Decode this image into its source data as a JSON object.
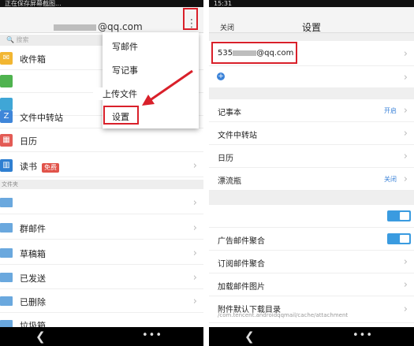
{
  "left": {
    "status_text": "正在保存屏幕截图...",
    "account_email_suffix": "@qq.com",
    "search_placeholder": "搜索",
    "rows": [
      {
        "label": "收件箱",
        "icon": "inbox-icon",
        "color": "#f2b632"
      },
      {
        "label": "",
        "icon": "star-icon",
        "color": "#4fb34f"
      },
      {
        "label": "",
        "icon": "contacts-icon",
        "color": "#3fa6d6"
      },
      {
        "label": "文件中转站",
        "icon": "transfer-icon",
        "color": "#3f86d9"
      },
      {
        "label": "日历",
        "icon": "calendar-icon",
        "color": "#e35b55"
      },
      {
        "label": "读书",
        "icon": "book-icon",
        "color": "#2f7fd1",
        "badge": "免费"
      }
    ],
    "section_label": "文件夹",
    "folders": [
      "",
      "群邮件",
      "草稿箱",
      "已发送",
      "已删除",
      "垃圾箱"
    ],
    "menu": {
      "items": [
        "写邮件",
        "写记事",
        "上传文件",
        "设置"
      ]
    }
  },
  "right": {
    "status_time": "15:31",
    "close_label": "关闭",
    "title": "设置",
    "account_prefix": "535",
    "account_suffix": "@qq.com",
    "items": [
      {
        "label": "记事本",
        "value": "开启"
      },
      {
        "label": "文件中转站",
        "value": ""
      },
      {
        "label": "日历",
        "value": ""
      },
      {
        "label": "漂流瓶",
        "value": "关闭"
      }
    ],
    "toggles": [
      {
        "label": "",
        "on": true
      },
      {
        "label": "广告邮件聚合",
        "on": true
      }
    ],
    "more_items": [
      "订阅邮件聚合",
      "加载邮件图片"
    ],
    "attachment": {
      "label": "附件默认下载目录",
      "path": "/com.tencent.androidqqmail/cache/attachment"
    }
  },
  "colors": {
    "highlight_red": "#d9202a",
    "link_blue": "#3a82d8"
  }
}
